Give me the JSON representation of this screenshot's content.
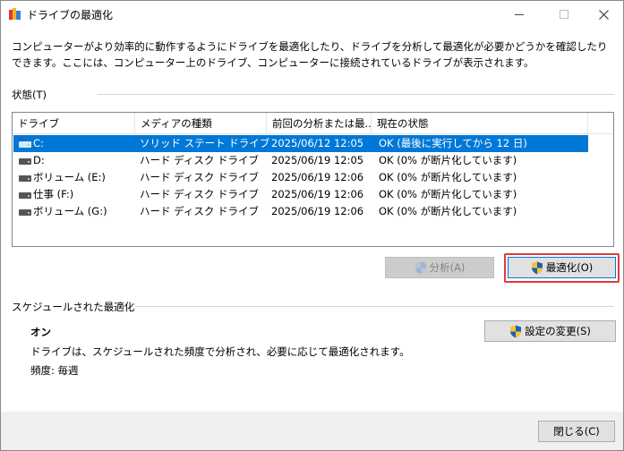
{
  "window": {
    "title": "ドライブの最適化"
  },
  "description": "コンピューターがより効率的に動作するようにドライブを最適化したり、ドライブを分析して最適化が必要かどうかを確認したりできます。ここには、コンピューター上のドライブ、コンピューターに接続されているドライブが表示されます。",
  "status_section": {
    "label": "状態(T)"
  },
  "drives": {
    "columns": [
      "ドライブ",
      "メディアの種類",
      "前回の分析または最...",
      "現在の状態"
    ],
    "rows": [
      {
        "drive": "C:",
        "media": "ソリッド ステート ドライブ",
        "last": "2025/06/12 12:05",
        "status": "OK (最後に実行してから 12 日)",
        "selected": true,
        "system": true
      },
      {
        "drive": "D:",
        "media": "ハード ディスク ドライブ",
        "last": "2025/06/19 12:05",
        "status": "OK (0% が断片化しています)",
        "selected": false,
        "system": false
      },
      {
        "drive": "ボリューム (E:)",
        "media": "ハード ディスク ドライブ",
        "last": "2025/06/19 12:06",
        "status": "OK (0% が断片化しています)",
        "selected": false,
        "system": false
      },
      {
        "drive": "仕事 (F:)",
        "media": "ハード ディスク ドライブ",
        "last": "2025/06/19 12:06",
        "status": "OK (0% が断片化しています)",
        "selected": false,
        "system": false
      },
      {
        "drive": "ボリューム (G:)",
        "media": "ハード ディスク ドライブ",
        "last": "2025/06/19 12:06",
        "status": "OK (0% が断片化しています)",
        "selected": false,
        "system": false
      }
    ]
  },
  "actions": {
    "analyze_label": "分析(A)",
    "analyze_enabled": false,
    "optimize_label": "最適化(O)"
  },
  "schedule": {
    "section_label": "スケジュールされた最適化",
    "state": "オン",
    "detail": "ドライブは、スケジュールされた頻度で分析され、必要に応じて最適化されます。",
    "frequency": "頻度: 毎週",
    "change_settings_label": "設定の変更(S)"
  },
  "footer": {
    "close_label": "閉じる(C)"
  },
  "colors": {
    "selection": "#0078d7",
    "highlight_outline": "#e03a3a"
  }
}
